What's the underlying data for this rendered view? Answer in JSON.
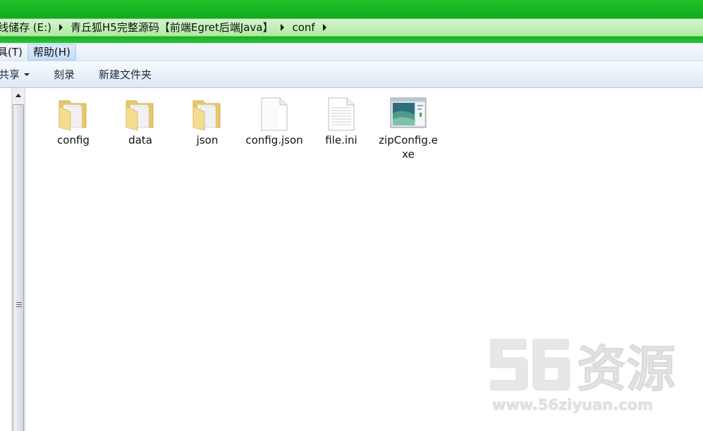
{
  "address": {
    "crumbs": [
      "线储存 (E:)",
      "青丘狐H5完整源码【前端Egret后端Java】",
      "conf"
    ]
  },
  "menu": {
    "items": [
      {
        "label": "具(T)",
        "active": false
      },
      {
        "label": "帮助(H)",
        "active": true
      }
    ]
  },
  "commands": {
    "share": "共享",
    "burn": "刻录",
    "new_folder": "新建文件夹"
  },
  "files": [
    {
      "name": "config",
      "type": "folder",
      "icon": "folder-icon"
    },
    {
      "name": "data",
      "type": "folder",
      "icon": "folder-icon"
    },
    {
      "name": "json",
      "type": "folder",
      "icon": "folder-icon"
    },
    {
      "name": "config.json",
      "type": "file",
      "icon": "blank-file-icon"
    },
    {
      "name": "file.ini",
      "type": "file",
      "icon": "text-file-icon"
    },
    {
      "name": "zipConfig.exe",
      "type": "exe",
      "icon": "app-window-icon"
    }
  ],
  "watermark": {
    "logo": "56资源",
    "url": "www.56ziyuan.com"
  },
  "colors": {
    "title_green": "#16b322",
    "address_bg": "#c2efb8",
    "folder_yellow": "#f2d98a"
  }
}
